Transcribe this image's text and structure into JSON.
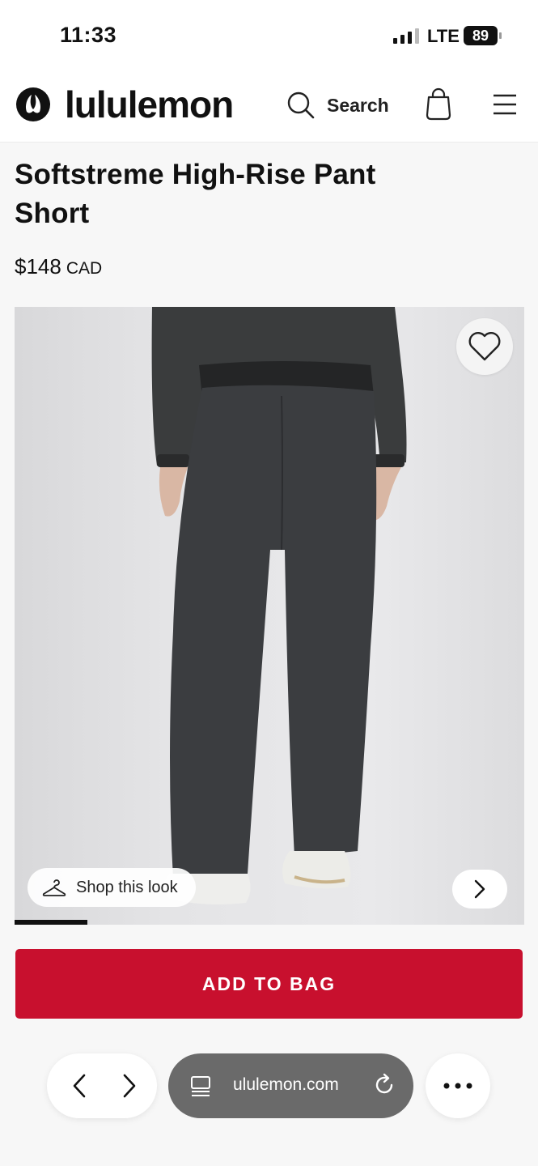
{
  "status_bar": {
    "time": "11:33",
    "network": "LTE",
    "battery": "89"
  },
  "header": {
    "brand": "lululemon",
    "search_label": "Search",
    "icons": [
      "lululemon-logo-icon",
      "search-icon",
      "shopping-bag-icon",
      "menu-icon"
    ]
  },
  "product": {
    "title": "Softstreme High-Rise Pant Short",
    "price": "$148",
    "currency": "CAD",
    "shop_look_label": "Shop this look",
    "image_carousel_progress": 0.143
  },
  "actions": {
    "add_to_bag_label": "ADD TO BAG"
  },
  "browser": {
    "url": "ulule­mon.com"
  },
  "colors": {
    "brand_red": "#c8102e",
    "text": "#111111",
    "url_pill": "#6a6a6a"
  }
}
